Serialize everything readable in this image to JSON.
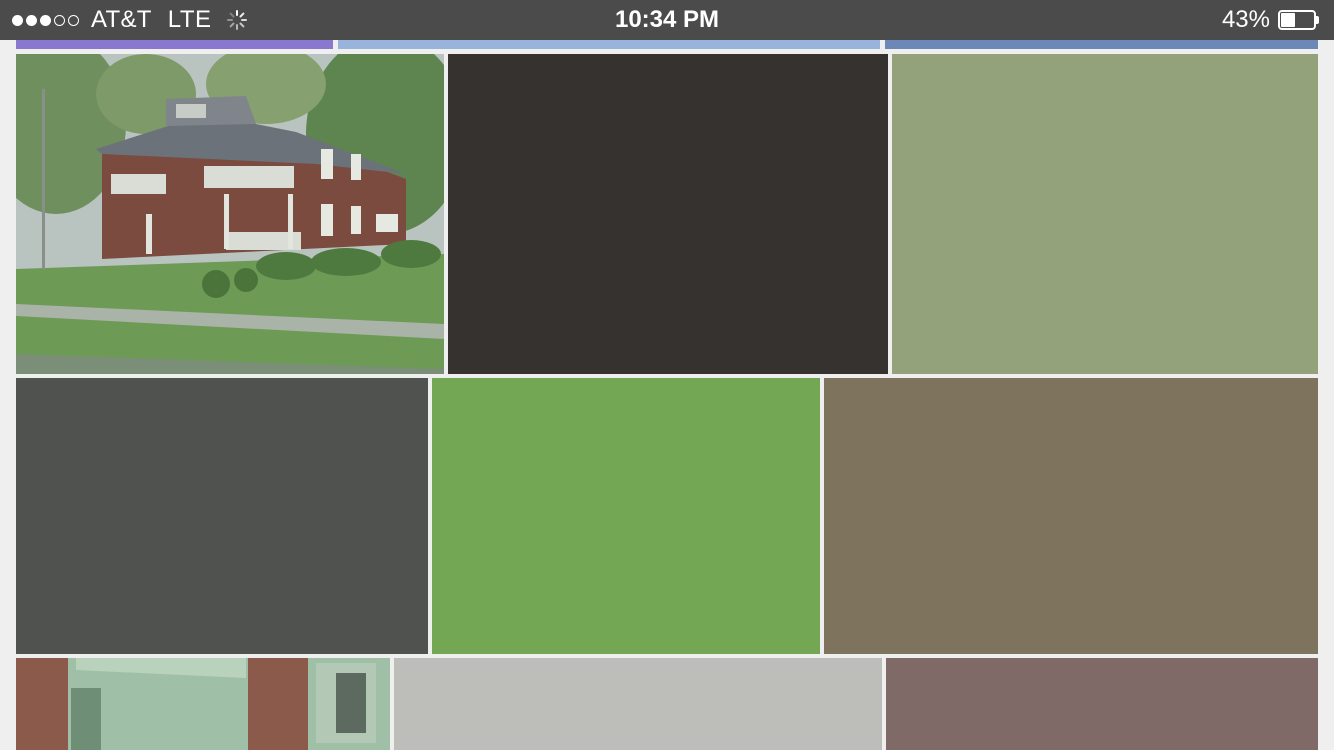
{
  "status_bar": {
    "signal_filled": 3,
    "signal_total": 5,
    "carrier": "AT&T",
    "network": "LTE",
    "time": "10:34 PM",
    "battery_percent_label": "43%",
    "battery_level": 0.43
  },
  "tabs": [
    {
      "color": "#8a78d0"
    },
    {
      "color": "#98b4da"
    },
    {
      "color": "#6b88b6"
    }
  ],
  "tiles": [
    {
      "kind": "photo-house",
      "color": "#5f7a55"
    },
    {
      "kind": "swatch",
      "color": "#353230"
    },
    {
      "kind": "swatch",
      "color": "#94a27c"
    },
    {
      "kind": "swatch",
      "color": "#50524f"
    },
    {
      "kind": "swatch",
      "color": "#74a753"
    },
    {
      "kind": "swatch",
      "color": "#7e735c"
    },
    {
      "kind": "photo-building",
      "color": "#9fc0a6"
    },
    {
      "kind": "swatch",
      "color": "#bdbeba"
    },
    {
      "kind": "swatch",
      "color": "#7f6a68"
    }
  ]
}
